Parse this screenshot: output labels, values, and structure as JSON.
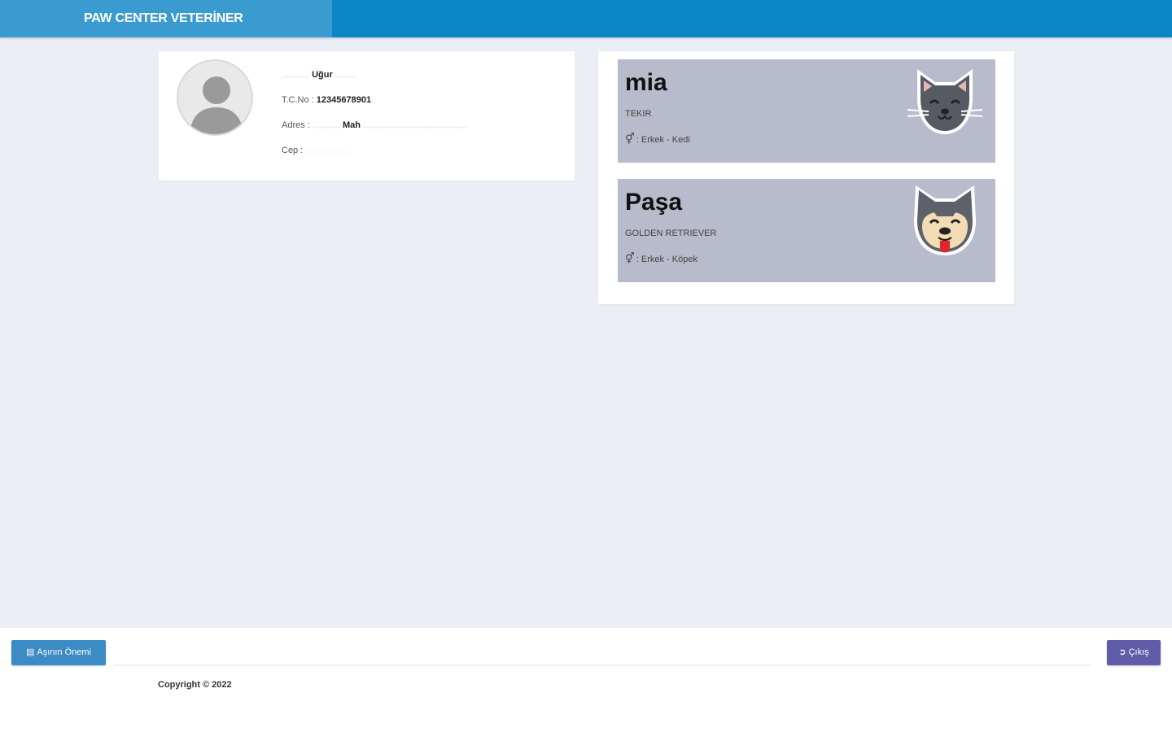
{
  "header": {
    "brand": "PAW CENTER VETERİNER"
  },
  "owner": {
    "name_first": "Uğur",
    "tc_label": "T.C.No :",
    "tc_value": "12345678901",
    "address_label": "Adres :",
    "address_value_mid": "Mah",
    "phone_label": "Cep :"
  },
  "pets": [
    {
      "name": "mia",
      "breed": "TEKIR",
      "gender_icon": "⚥",
      "meta": ": Erkek - Kedi",
      "icon": "cat-icon"
    },
    {
      "name": "Paşa",
      "breed": "GOLDEN RETRIEVER",
      "gender_icon": "⚥",
      "meta": ": Erkek - Köpek",
      "icon": "dog-icon"
    }
  ],
  "footer": {
    "left_button": "Aşının Önemi",
    "right_button": "Çıkış",
    "copyright": "Copyright © 2022"
  },
  "colors": {
    "header_bg": "#0b86c6",
    "brand_bg": "#3a9bd0",
    "pet_card_bg": "#b7bbcc",
    "btn_blue": "#3b8bc4",
    "btn_purple": "#605ca8"
  }
}
